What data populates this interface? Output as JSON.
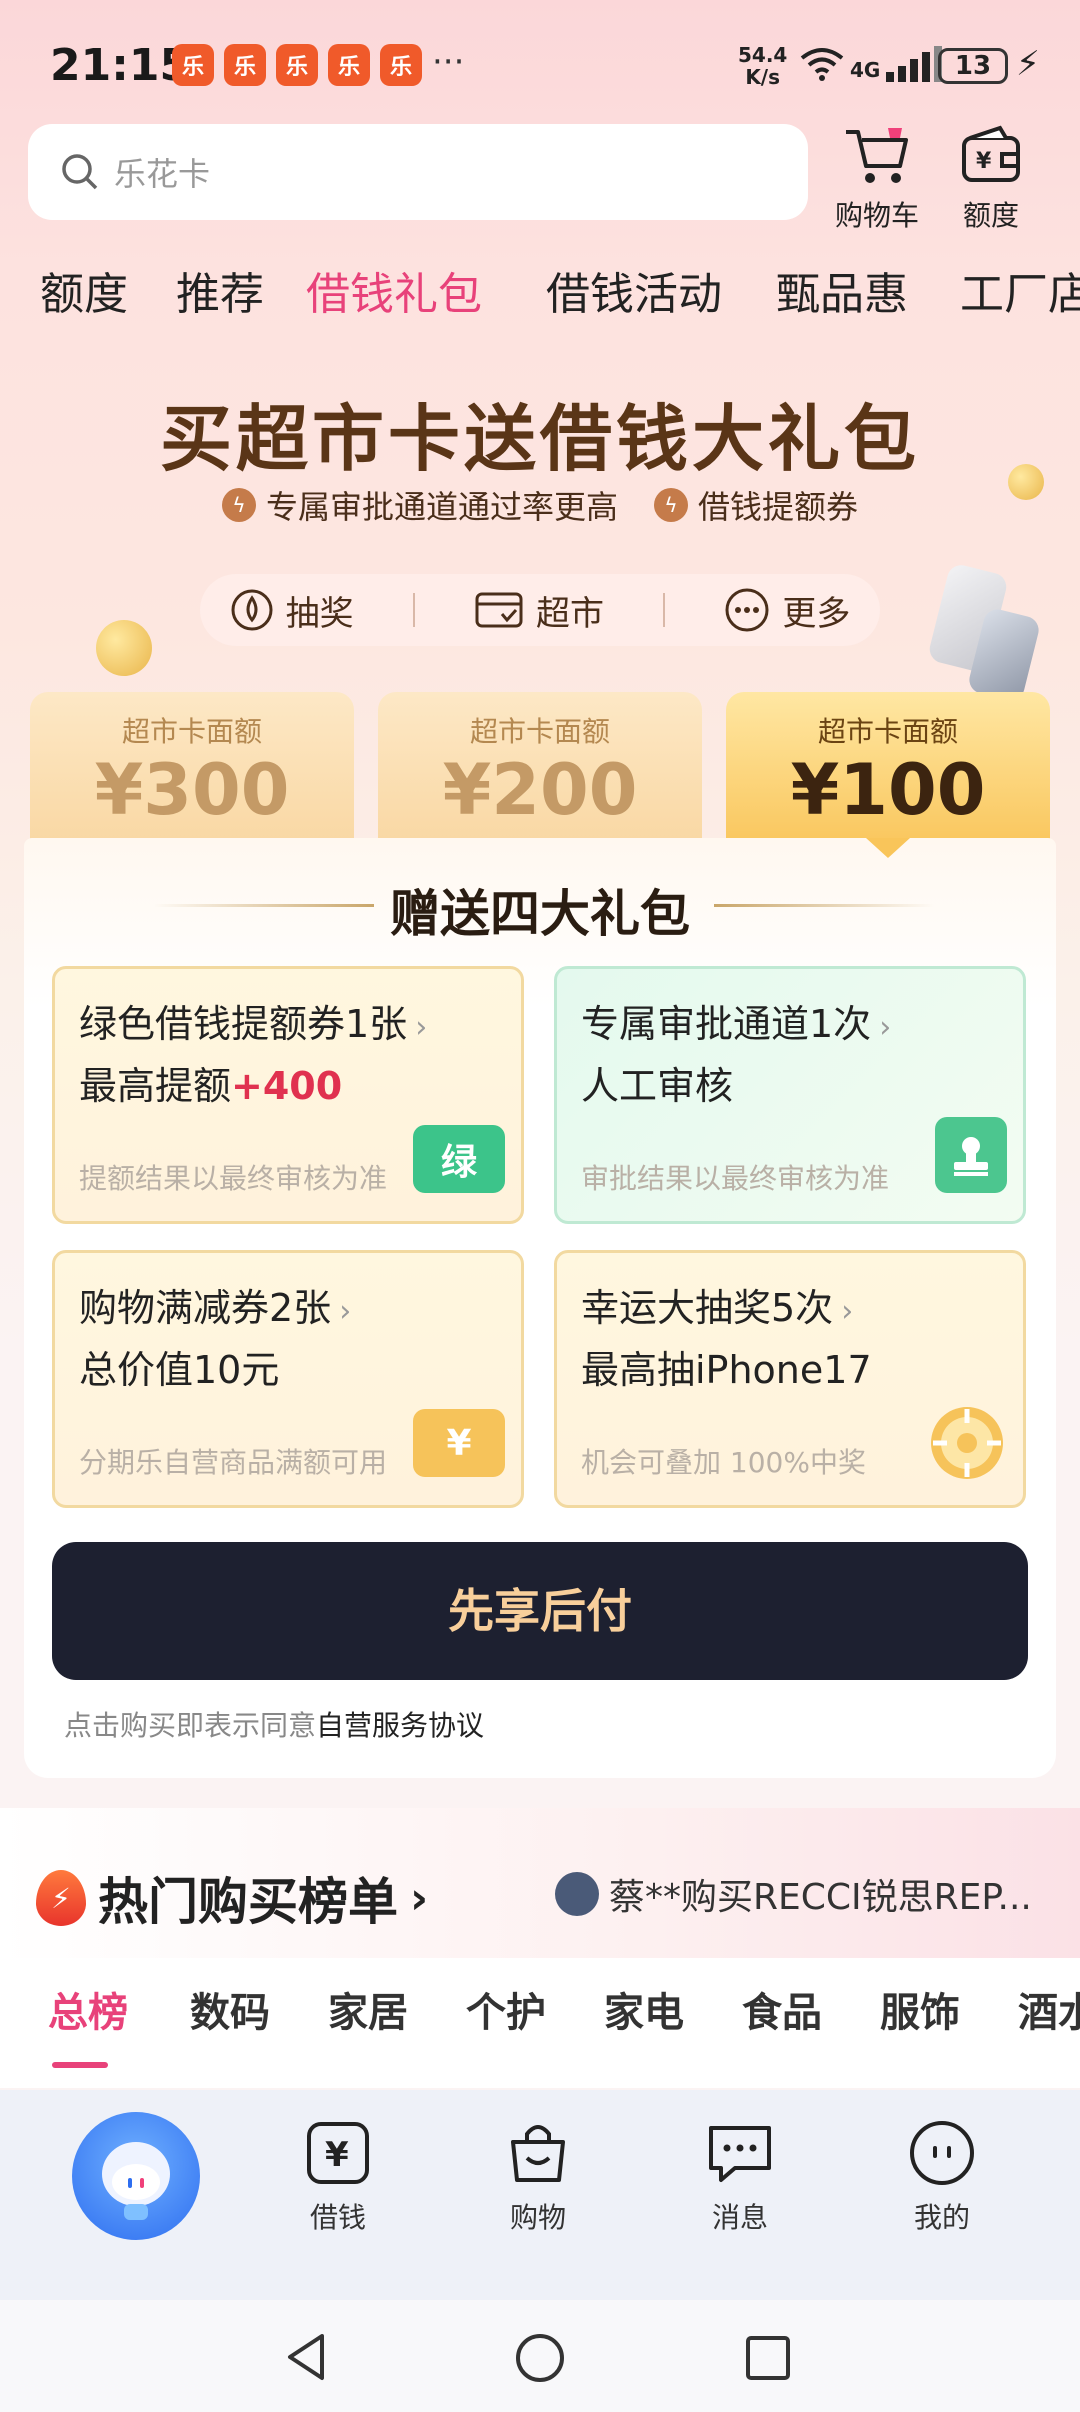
{
  "status_bar": {
    "time": "21:15",
    "more": "···",
    "net_speed_top": "54.4",
    "net_speed_bottom": "K/s",
    "network": "4G",
    "battery": "13"
  },
  "search": {
    "placeholder": "乐花卡",
    "icon": "search-icon"
  },
  "header_buttons": {
    "cart_label": "购物车",
    "quota_label": "额度"
  },
  "category_tabs": [
    "额度",
    "推荐",
    "借钱礼包",
    "借钱活动",
    "甄品惠",
    "工厂店"
  ],
  "category_active": "借钱礼包",
  "banner": {
    "title": "买超市卡送借钱大礼包",
    "sub1": "专属审批通道通过率更高",
    "sub2": "借钱提额券",
    "quick": [
      "抽奖",
      "超市",
      "更多"
    ]
  },
  "card_tabs": [
    {
      "label": "超市卡面额",
      "value": "¥300"
    },
    {
      "label": "超市卡面额",
      "value": "¥200"
    },
    {
      "label": "超市卡面额",
      "value": "¥100"
    }
  ],
  "panel": {
    "title": "赠送四大礼包",
    "gifts": [
      {
        "title": "绿色借钱提额券1张",
        "line2_prefix": "最高提额",
        "line2_highlight": "+400",
        "note": "提额结果以最终审核为准",
        "icon_text": "绿",
        "color": "#3cc48a"
      },
      {
        "title": "专属审批通道1次",
        "line2_prefix": "人工审核",
        "line2_highlight": "",
        "note": "审批结果以最终审核为准",
        "icon_text": "",
        "color": "#4cc68f"
      },
      {
        "title": "购物满减券2张",
        "line2_prefix": "总价值10元",
        "line2_highlight": "",
        "note": "分期乐自营商品满额可用",
        "icon_text": "¥",
        "color": "#f6c35a"
      },
      {
        "title": "幸运大抽奖5次",
        "line2_prefix": "最高抽iPhone17",
        "line2_highlight": "",
        "note": "机会可叠加 100%中奖",
        "icon_text": "",
        "color": "#f6c35a"
      }
    ],
    "cta": "先享后付",
    "agree_prefix": "点击购买即表示同意",
    "agree_link": "自营服务协议"
  },
  "hot": {
    "title": "热门购买榜单",
    "ticker": "蔡**购买RECCI锐思REP...",
    "tabs": [
      "总榜",
      "数码",
      "家居",
      "个护",
      "家电",
      "食品",
      "服饰",
      "酒水"
    ],
    "active": "总榜"
  },
  "bottom_nav": [
    {
      "label": "借钱",
      "icon": "yuan-icon"
    },
    {
      "label": "购物",
      "icon": "bag-icon"
    },
    {
      "label": "消息",
      "icon": "chat-icon"
    },
    {
      "label": "我的",
      "icon": "profile-icon"
    }
  ],
  "colors": {
    "accent": "#e8427a",
    "cta_bg": "#1d2030",
    "cta_text": "#f8cf9b",
    "highlight": "#e0314f"
  }
}
